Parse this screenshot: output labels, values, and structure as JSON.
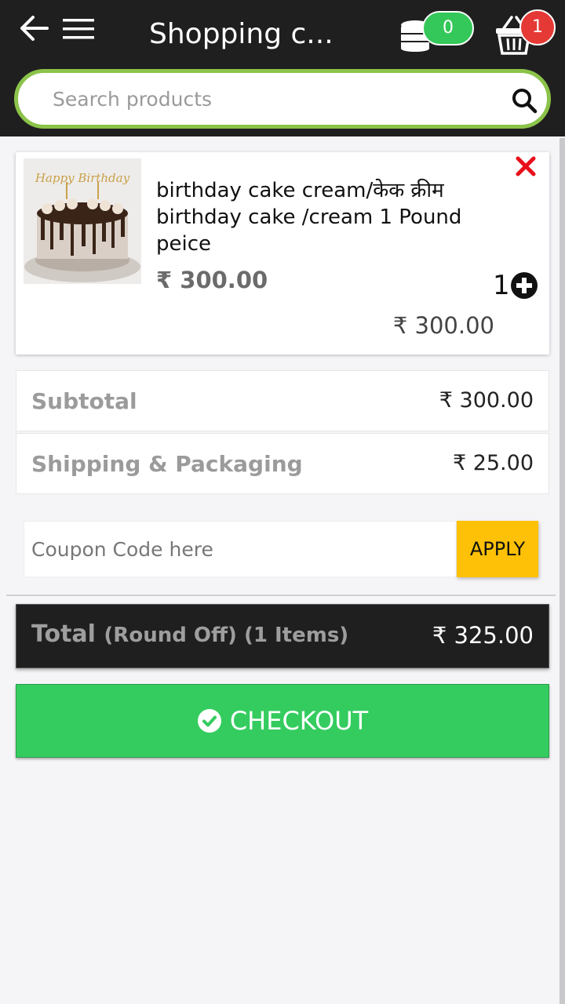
{
  "header": {
    "title": "Shopping c...",
    "coins_count": "0",
    "cart_count": "1"
  },
  "search": {
    "placeholder": "Search products"
  },
  "cart_items": [
    {
      "name": "birthday cake cream/केक क्रीम birthday cake /cream 1 Pound peice",
      "image_text": "Happy Birthday",
      "price": "₹ 300.00",
      "quantity": "1",
      "line_total": "₹ 300.00"
    }
  ],
  "summary": {
    "subtotal_label": "Subtotal",
    "subtotal_value": "₹ 300.00",
    "shipping_label": "Shipping & Packaging",
    "shipping_value": "₹ 25.00"
  },
  "coupon": {
    "placeholder": "Coupon Code here",
    "apply_label": "APPLY"
  },
  "total": {
    "label": "Total",
    "note": "(Round Off) (1 Items)",
    "value": "₹ 325.00"
  },
  "checkout": {
    "label": "CHECKOUT"
  },
  "colors": {
    "header_bg": "#1f1f1f",
    "search_border": "#8bc34a",
    "coin_badge": "#34c759",
    "cart_badge": "#e53935",
    "apply_button": "#ffc107",
    "checkout_button": "#34cc5f",
    "remove_icon": "#e8101a"
  },
  "icons": {
    "back": "arrow-left-icon",
    "menu": "hamburger-icon",
    "coins": "coin-stack-icon",
    "cart": "shopping-basket-icon",
    "search": "search-icon",
    "remove": "close-icon",
    "increase": "plus-circle-icon",
    "checkout": "check-circle-icon"
  }
}
